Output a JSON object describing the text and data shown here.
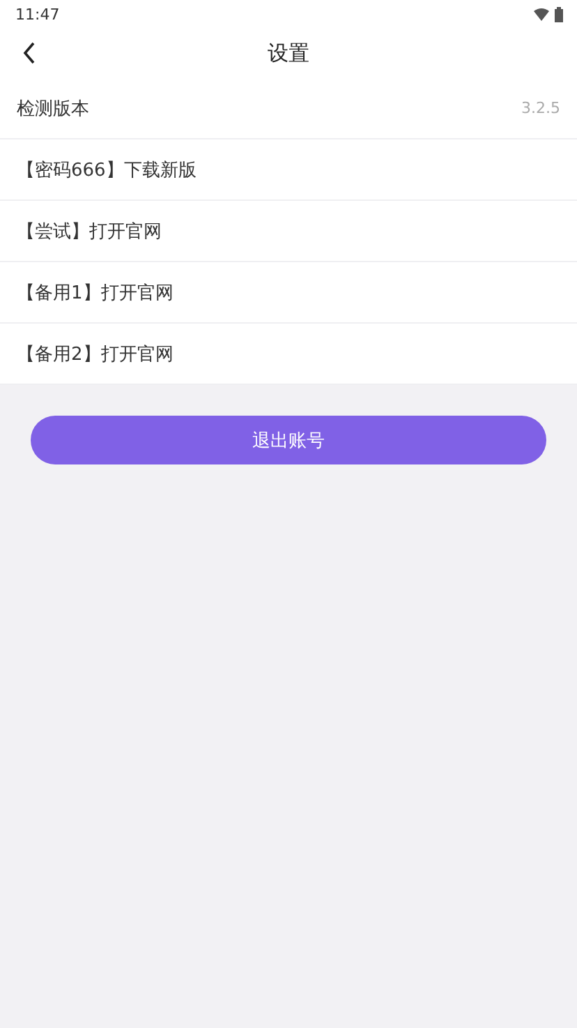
{
  "status_bar": {
    "time": "11:47"
  },
  "header": {
    "title": "设置"
  },
  "rows": [
    {
      "label": "检测版本",
      "value": "3.2.5"
    },
    {
      "label": "【密码666】下载新版"
    },
    {
      "label": "【尝试】打开官网"
    },
    {
      "label": "【备用1】打开官网"
    },
    {
      "label": "【备用2】打开官网"
    }
  ],
  "logout_button": {
    "label": "退出账号"
  }
}
